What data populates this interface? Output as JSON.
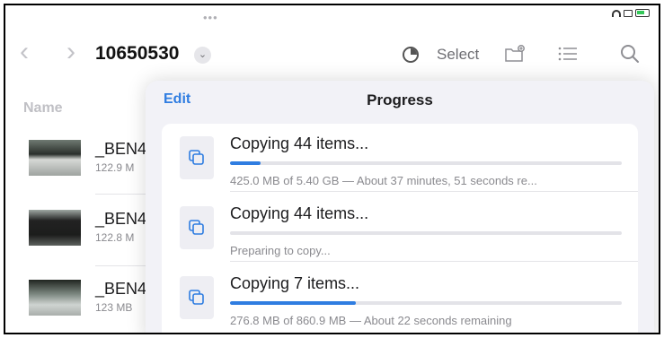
{
  "status_bar": {
    "dots": "•••"
  },
  "nav": {
    "back_icon": "chevron-left-icon",
    "forward_icon": "chevron-right-icon",
    "folder_title": "10650530",
    "title_menu_icon": "chevron-down-circle-icon",
    "select_label": "Select"
  },
  "file_list": {
    "column_header": "Name",
    "items": [
      {
        "name": "_BEN4",
        "size": "122.9 M"
      },
      {
        "name": "_BEN4",
        "size": "122.8 M"
      },
      {
        "name": "_BEN4",
        "size": "123 MB"
      }
    ]
  },
  "progress_popover": {
    "edit_label": "Edit",
    "title": "Progress",
    "operations": [
      {
        "title": "Copying 44 items...",
        "status": "425.0 MB of 5.40 GB — About 37 minutes, 51 seconds re...",
        "progress": 0.077
      },
      {
        "title": "Copying 44 items...",
        "status": "Preparing to copy...",
        "progress": 0.0
      },
      {
        "title": "Copying 7 items...",
        "status": "276.8 MB of 860.9 MB — About 22 seconds remaining",
        "progress": 0.32
      }
    ]
  },
  "colors": {
    "accent": "#2f7de1",
    "background": "#f2f2f7"
  }
}
